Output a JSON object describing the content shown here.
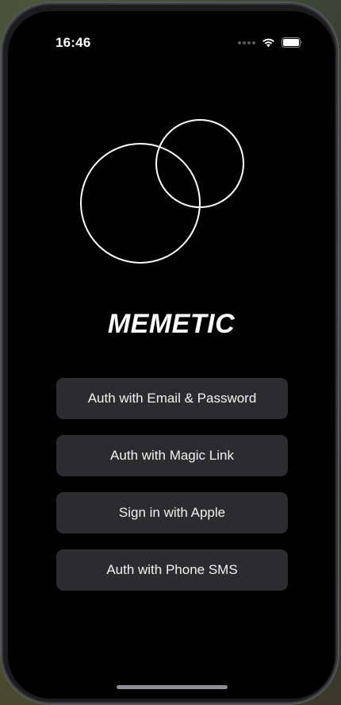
{
  "status_bar": {
    "time": "16:46",
    "icons": [
      "cellular-signal-icon",
      "wifi-icon",
      "battery-icon"
    ]
  },
  "logo": {
    "icon": "overlapping-circles-logo",
    "stroke_color": "#ffffff"
  },
  "brand": {
    "title": "MEMETIC"
  },
  "auth": {
    "buttons": [
      {
        "label": "Auth with Email & Password"
      },
      {
        "label": "Auth with Magic Link"
      },
      {
        "label": "Sign in with Apple"
      },
      {
        "label": "Auth with Phone SMS"
      }
    ]
  },
  "colors": {
    "screen_background": "#000000",
    "button_background": "#2c2c2e",
    "text": "#ffffff"
  }
}
